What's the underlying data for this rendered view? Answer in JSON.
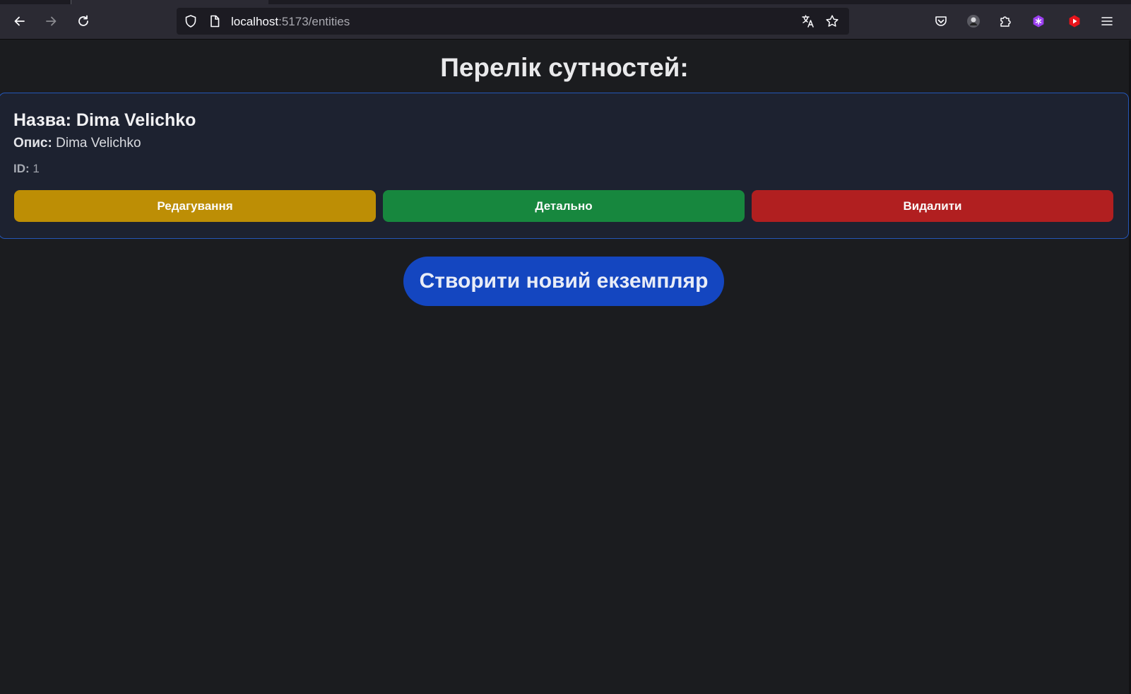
{
  "browser": {
    "url_host": "localhost",
    "url_rest": ":5173/entities",
    "icons": {
      "back": "arrow-left-icon",
      "forward": "arrow-right-icon",
      "reload": "reload-icon",
      "shield": "shield-icon",
      "page": "page-icon",
      "translate": "translate-icon",
      "bookmark": "star-icon",
      "pocket": "pocket-icon",
      "account": "avatar-icon",
      "extensions": "puzzle-icon",
      "extension_purple": "purple-extension-icon",
      "extension_youtube": "youtube-extension-icon",
      "menu": "hamburger-menu-icon"
    }
  },
  "page": {
    "title": "Перелік сутностей:",
    "entity": {
      "name_label": "Назва:",
      "name_value": "Dima Velichko",
      "desc_label": "Опис:",
      "desc_value": "Dima Velichko",
      "id_label": "ID:",
      "id_value": "1"
    },
    "buttons": {
      "edit": "Редагування",
      "details": "Детально",
      "delete": "Видалити"
    },
    "create_button": "Створити новий екземпляр"
  },
  "colors": {
    "background": "#1b1c1f",
    "card_bg": "#1d2230",
    "card_border": "#2456b8",
    "edit": "#bd8e05",
    "details": "#17873e",
    "delete": "#b11f20",
    "create": "#1446c0"
  }
}
